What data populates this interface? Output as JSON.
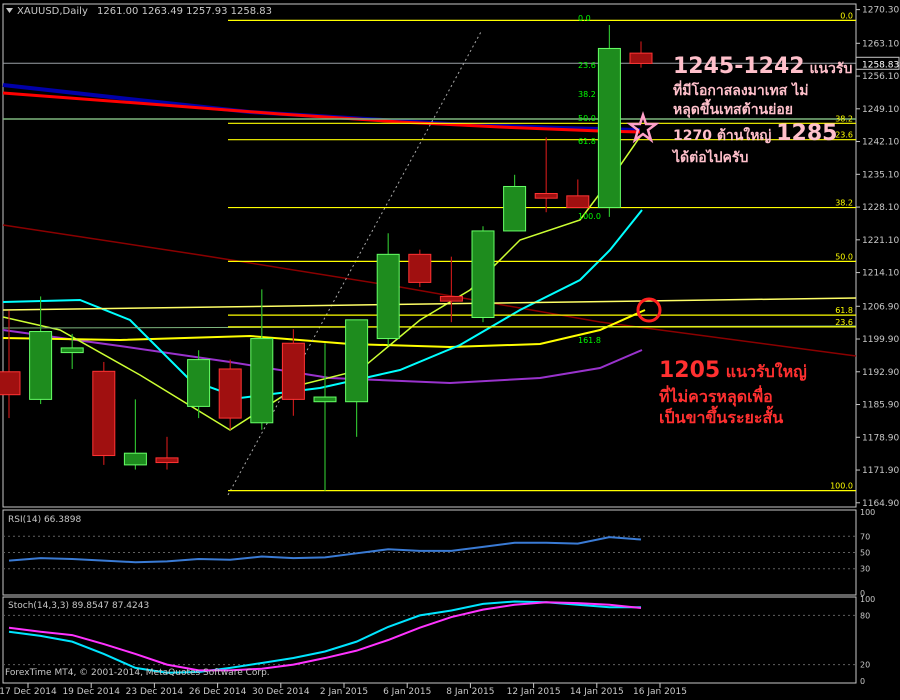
{
  "header": {
    "symbol_text": "XAUUSD,Daily",
    "ohlc_text": "1261.00 1263.49 1257.93 1258.83"
  },
  "footer": {
    "copyright": "ForexTime MT4, © 2001-2014, MetaQuotes Software Corp."
  },
  "colors": {
    "background": "#000000",
    "axis": "#c8c8c8",
    "grid": "#404040",
    "bull_candle": "#1e8c1e",
    "bear_candle": "#a01010",
    "fib_line": "#ffff00",
    "fib_label": "#00ff00",
    "ma_blue": "#0000aa",
    "ma_red": "#ff0000",
    "ma_yellow": "#ffff00",
    "ma_purple": "#9933cc",
    "ma_cyan": "#00ffff",
    "ma_lightgreen": "#ccff33",
    "trend_red": "#8b0000",
    "annotation_pink": "#ffc0cb",
    "annotation_red": "#ff3030"
  },
  "annotations": {
    "top": {
      "lines": [
        {
          "big": "1245-1242",
          "small": " แนวรับ"
        },
        {
          "big": "",
          "small": "ที่มีโอกาสลงมาเทส ไม่"
        },
        {
          "big": "",
          "small": "หลุดขึ้นเทสต้านย่อย"
        },
        {
          "big_prefix": "1270 ต้านใหญ่ ",
          "big": "1285"
        },
        {
          "big": "",
          "small": "ได้ต่อไปครับ"
        }
      ]
    },
    "bottom": {
      "lines": [
        {
          "big": "1205",
          "small": " แนวรับใหญ่"
        },
        {
          "big": "",
          "small": "ที่ไม่ควรหลุดเพื่อ"
        },
        {
          "big": "",
          "small": "เป็นขาขึ้นระยะสั้น"
        }
      ]
    }
  },
  "chart_data": [
    {
      "type": "candlestick",
      "title": "XAUUSD,Daily",
      "x_labels": [
        "17 Dec 2014",
        "19 Dec 2014",
        "23 Dec 2014",
        "26 Dec 2014",
        "30 Dec 2014",
        "2 Jan 2015",
        "6 Jan 2015",
        "8 Jan 2015",
        "12 Jan 2015",
        "14 Jan 2015",
        "16 Jan 2015"
      ],
      "y_ticks": [
        1270.3,
        1263.1,
        1256.1,
        1249.1,
        1242.1,
        1235.1,
        1228.1,
        1221.1,
        1214.1,
        1206.9,
        1199.9,
        1192.9,
        1185.9,
        1178.9,
        1171.9,
        1164.9
      ],
      "ylim": [
        1164.0,
        1271.5
      ],
      "current_price": "1258.83",
      "candles": [
        {
          "o": 1192.9,
          "h": 1206.0,
          "l": 1183.0,
          "c": 1188.0
        },
        {
          "o": 1187.0,
          "h": 1209.0,
          "l": 1186.0,
          "c": 1201.5
        },
        {
          "o": 1197.0,
          "h": 1201.0,
          "l": 1193.5,
          "c": 1198.0
        },
        {
          "o": 1193.0,
          "h": 1195.0,
          "l": 1173.0,
          "c": 1175.0
        },
        {
          "o": 1173.0,
          "h": 1187.0,
          "l": 1172.0,
          "c": 1175.5
        },
        {
          "o": 1174.5,
          "h": 1179.0,
          "l": 1172.0,
          "c": 1173.5
        },
        {
          "o": 1185.5,
          "h": 1197.5,
          "l": 1183.0,
          "c": 1195.5
        },
        {
          "o": 1193.5,
          "h": 1195.5,
          "l": 1180.5,
          "c": 1183.0
        },
        {
          "o": 1182.0,
          "h": 1210.5,
          "l": 1180.5,
          "c": 1200.0
        },
        {
          "o": 1199.0,
          "h": 1202.0,
          "l": 1183.5,
          "c": 1187.0
        },
        {
          "o": 1186.5,
          "h": 1199.0,
          "l": 1167.5,
          "c": 1187.5
        },
        {
          "o": 1186.5,
          "h": 1204.0,
          "l": 1179.0,
          "c": 1204.0
        },
        {
          "o": 1200.0,
          "h": 1222.5,
          "l": 1198.5,
          "c": 1218.0
        },
        {
          "o": 1218.0,
          "h": 1219.0,
          "l": 1211.0,
          "c": 1212.0
        },
        {
          "o": 1209.0,
          "h": 1217.5,
          "l": 1203.5,
          "c": 1208.0
        },
        {
          "o": 1204.5,
          "h": 1224.0,
          "l": 1203.5,
          "c": 1223.0
        },
        {
          "o": 1223.0,
          "h": 1235.0,
          "l": 1223.0,
          "c": 1232.5
        },
        {
          "o": 1231.0,
          "h": 1243.0,
          "l": 1227.0,
          "c": 1230.0
        },
        {
          "o": 1230.5,
          "h": 1234.0,
          "l": 1229.0,
          "c": 1228.0
        },
        {
          "o": 1228.0,
          "h": 1267.0,
          "l": 1226.0,
          "c": 1262.0
        },
        {
          "o": 1261.0,
          "h": 1263.5,
          "l": 1257.9,
          "c": 1258.8
        }
      ],
      "fibonacci_levels": [
        {
          "label": "0.0",
          "value": 1268.0
        },
        {
          "label": "38.2",
          "value": 1246.0
        },
        {
          "label": "23.6",
          "value": 1242.5
        },
        {
          "label": "38.2",
          "value": 1228.0
        },
        {
          "label": "50.0",
          "value": 1216.5
        },
        {
          "label": "61.8",
          "value": 1205.0
        },
        {
          "label": "23.6",
          "value": 1202.5
        },
        {
          "label": "100.0",
          "value": 1167.5
        }
      ],
      "fib_small_labels": [
        "0.0",
        "23.6",
        "38.2",
        "50.0",
        "61.8",
        "100.0",
        "161.8"
      ]
    },
    {
      "type": "line",
      "title": "RSI(14) 66.3898",
      "y_ticks": [
        100,
        70,
        50,
        30,
        0
      ],
      "ylim": [
        0,
        100
      ],
      "levels": [
        70,
        50,
        30
      ],
      "series": [
        {
          "name": "RSI(14)",
          "values": [
            40,
            43,
            42,
            40,
            38,
            39,
            42,
            41,
            45,
            43,
            44,
            49,
            54,
            52,
            52,
            57,
            62,
            62,
            61,
            69,
            66
          ]
        }
      ]
    },
    {
      "type": "line",
      "title": "Stoch(14,3,3) 89.8547 87.4243",
      "y_ticks": [
        100,
        80,
        20,
        0
      ],
      "ylim": [
        0,
        100
      ],
      "levels": [
        80,
        20
      ],
      "series": [
        {
          "name": "main",
          "values": [
            60,
            55,
            48,
            33,
            16,
            10,
            11,
            16,
            22,
            28,
            36,
            48,
            66,
            80,
            86,
            94,
            97,
            96,
            93,
            90,
            90
          ]
        },
        {
          "name": "signal",
          "values": [
            65,
            60,
            56,
            45,
            33,
            20,
            13,
            13,
            15,
            20,
            28,
            37,
            50,
            65,
            78,
            87,
            93,
            96,
            95,
            93,
            89
          ]
        }
      ]
    }
  ]
}
